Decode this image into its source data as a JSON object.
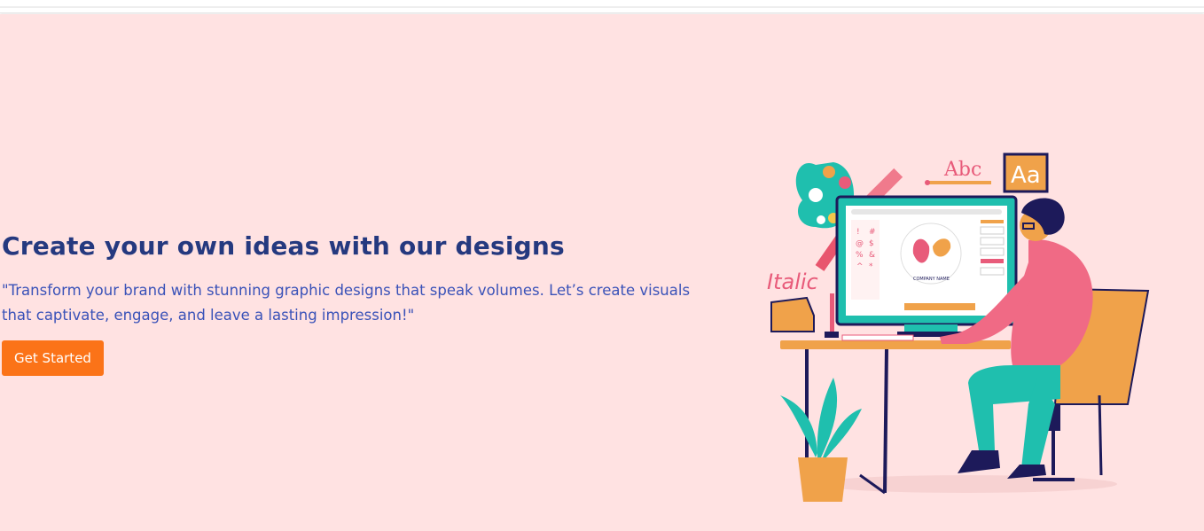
{
  "hero": {
    "title": "Create your own ideas with our designs",
    "text": "\"Transform your brand with stunning graphic designs that speak volumes. Let’s create visuals that captivate, engage, and leave a lasting impression!\"",
    "cta_label": "Get Started"
  },
  "illustration": {
    "label_abc": "Abc",
    "label_aa": "Aa",
    "label_italic": "Italic",
    "label_company": "COMPANY NAME",
    "symbols": [
      "!",
      "#",
      "@",
      "$",
      "%",
      "&",
      "^",
      "*"
    ]
  },
  "colors": {
    "hero_bg": "#ffe2e2",
    "title": "#25397f",
    "text": "#3a52b8",
    "cta": "#fb7318"
  }
}
